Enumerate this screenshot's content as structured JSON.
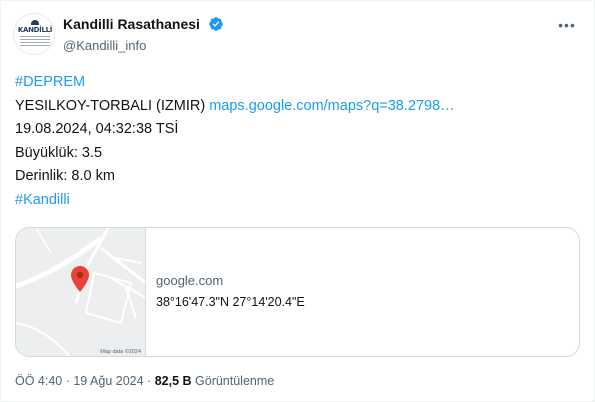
{
  "author": {
    "avatar_text": "KANDİLLİ",
    "display_name": "Kandilli Rasathanesi",
    "handle": "@Kandilli_info",
    "verified_icon": "verified-badge-icon",
    "verified_color": "#1d9bf0"
  },
  "tweet": {
    "hashtag_1": "#DEPREM",
    "location_text": "YESILKOY-TORBALI (IZMIR)",
    "location_link": "maps.google.com/maps?q=38.2798…",
    "datetime": "19.08.2024, 04:32:38 TSİ",
    "magnitude": "Büyüklük: 3.5",
    "depth": "Derinlik: 8.0 km",
    "hashtag_2": "#Kandilli"
  },
  "card": {
    "domain": "google.com",
    "title": "38°16'47.3\"N 27°14'20.4\"E",
    "map_credit": "Map data ©2024",
    "pin_color": "#ea4335"
  },
  "meta": {
    "time": "ÖÖ 4:40",
    "separator": " · ",
    "date": "19 Ağu 2024",
    "views_count": "82,5 B",
    "views_label": "Görüntülenme"
  },
  "colors": {
    "link": "#1d9bf0",
    "secondary_text": "#536471",
    "primary_text": "#0f1419"
  }
}
